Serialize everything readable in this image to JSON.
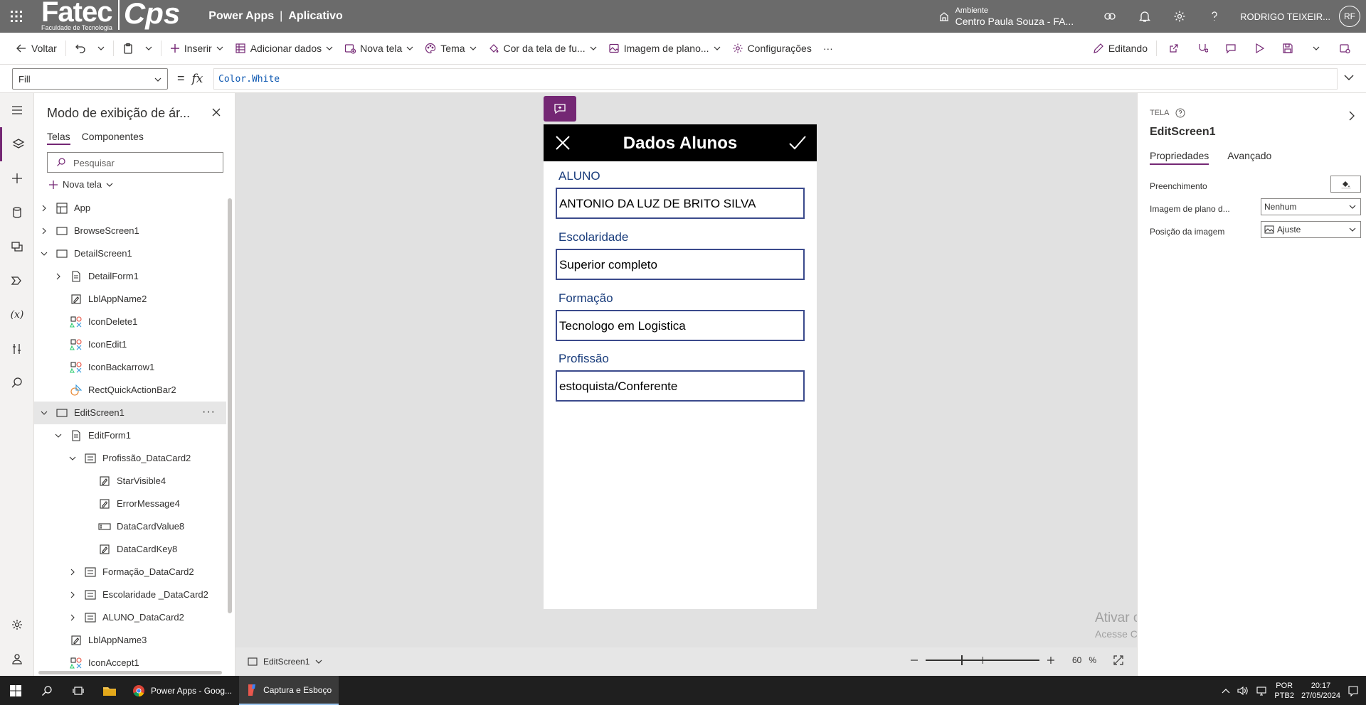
{
  "header": {
    "logo_fatec": "Fatec",
    "logo_fatec_sub": "Faculdade de Tecnologia",
    "logo_cps": "Cps",
    "product": "Power Apps",
    "separator": "|",
    "app": "Aplicativo",
    "env_label": "Ambiente",
    "env_value": "Centro Paula Souza - FA...",
    "user": "RODRIGO TEIXEIR...",
    "avatar": "RF"
  },
  "toolbar": {
    "back": "Voltar",
    "insert": "Inserir",
    "add_data": "Adicionar dados",
    "new_screen": "Nova tela",
    "theme": "Tema",
    "bg_color": "Cor da tela de fu...",
    "bg_image": "Imagem de plano...",
    "settings": "Configurações",
    "more": "···",
    "editing": "Editando"
  },
  "formula": {
    "property": "Fill",
    "equals": "=",
    "fx": "fx",
    "value": "Color.White"
  },
  "treeview": {
    "title": "Modo de exibição de ár...",
    "tab_screens": "Telas",
    "tab_components": "Componentes",
    "search_placeholder": "Pesquisar",
    "new_screen": "Nova tela",
    "nodes": [
      {
        "label": "App"
      },
      {
        "label": "BrowseScreen1"
      },
      {
        "label": "DetailScreen1"
      },
      {
        "label": "DetailForm1"
      },
      {
        "label": "LblAppName2"
      },
      {
        "label": "IconDelete1"
      },
      {
        "label": "IconEdit1"
      },
      {
        "label": "IconBackarrow1"
      },
      {
        "label": "RectQuickActionBar2"
      },
      {
        "label": "EditScreen1",
        "more": "···"
      },
      {
        "label": "EditForm1"
      },
      {
        "label": "Profissão_DataCard2"
      },
      {
        "label": "StarVisible4"
      },
      {
        "label": "ErrorMessage4"
      },
      {
        "label": "DataCardValue8"
      },
      {
        "label": "DataCardKey8"
      },
      {
        "label": "Formação_DataCard2"
      },
      {
        "label": "Escolaridade _DataCard2"
      },
      {
        "label": "ALUNO_DataCard2"
      },
      {
        "label": "LblAppName3"
      },
      {
        "label": "IconAccept1"
      }
    ]
  },
  "canvas": {
    "screen_title": "Dados Alunos",
    "fields": [
      {
        "label": "ALUNO",
        "value": "ANTONIO DA LUZ DE BRITO SILVA"
      },
      {
        "label": "Escolaridade",
        "value": "Superior completo"
      },
      {
        "label": "Formação",
        "value": "Tecnologo em Logistica"
      },
      {
        "label": "Profissão",
        "value": "estoquista/Conferente"
      }
    ],
    "screen_selector": "EditScreen1",
    "zoom_value": "60",
    "zoom_unit": "%",
    "watermark_title": "Ativar o Windows",
    "watermark_sub": "Acesse Configurações para ativar o Windows."
  },
  "properties": {
    "kind": "TELA",
    "name": "EditScreen1",
    "tab_properties": "Propriedades",
    "tab_advanced": "Avançado",
    "fill_label": "Preenchimento",
    "bg_image_label": "Imagem de plano d...",
    "bg_image_value": "Nenhum",
    "image_pos_label": "Posição da imagem",
    "image_pos_value": "Ajuste"
  },
  "taskbar": {
    "app_chrome": "Power Apps - Goog...",
    "app_snip": "Captura e Esboço",
    "lang_1": "POR",
    "lang_2": "PTB2",
    "time": "20:17",
    "date": "27/05/2024"
  },
  "colors": {
    "accent": "#742774",
    "header_bg": "#6b6b6b",
    "field_border": "#3b4a8c",
    "field_label": "#1a3d7c"
  }
}
